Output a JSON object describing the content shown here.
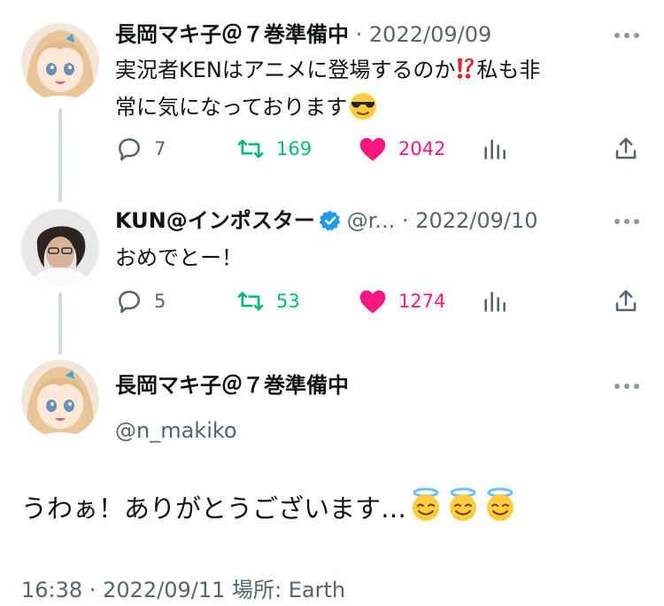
{
  "tweet1": {
    "name": "長岡マキ子＠７巻準備中",
    "date": "· 2022/09/09",
    "text_line1": "実況者KENはアニメに登場するのか",
    "text_line1b": "私も非",
    "text_line2": "常に気になっております",
    "replies": "7",
    "retweets": "169",
    "likes": "2042"
  },
  "tweet2": {
    "name": "KUN@インポスター",
    "handle": "@r...",
    "date": "· 2022/09/10",
    "text": "おめでとー！",
    "replies": "5",
    "retweets": "53",
    "likes": "1274"
  },
  "main": {
    "name": "長岡マキ子＠７巻準備中",
    "handle": "@n_makiko",
    "text": "うわぁ！ありがとうございます…",
    "footer": "16:38 · 2022/09/11 場所: Earth"
  },
  "colors": {
    "retweet": "#00ba7c",
    "like": "#f91880",
    "meta": "#536471",
    "verified": "#1d9bf0"
  },
  "icons": [
    "reply-icon",
    "retweet-icon",
    "like-icon",
    "views-icon",
    "share-icon",
    "more-icon",
    "verified-icon",
    "interrobang-emoji",
    "sunglasses-emoji",
    "halo-emoji"
  ]
}
